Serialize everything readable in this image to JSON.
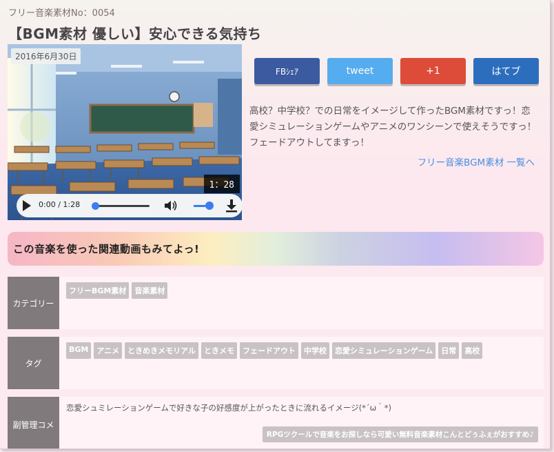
{
  "header": {
    "supertitle": "フリー音楽素材No：0054",
    "title": "【BGM素材 優しい】安心できる気持ち"
  },
  "media": {
    "date": "2016年6月30日",
    "duration": "1：28",
    "player": {
      "time": "0:00 / 1:28",
      "progress": 0,
      "volume": 1
    }
  },
  "share": {
    "facebook": "FBｼｪｱ",
    "twitter": "tweet",
    "gplus": "+1",
    "hatena": "はてブ"
  },
  "description": {
    "text": "高校？中学校？での日常をイメージして作ったBGM素材ですっ！恋愛シミュレーションゲームやアニメのワンシーンで使えそうですっ！フェードアウトしてますっ！",
    "link": "フリー音楽BGM素材 一覧へ"
  },
  "related": {
    "heading": "この音楽を使った関連動画もみてよっ!"
  },
  "meta": {
    "category": {
      "label": "カテゴリー",
      "items": [
        "フリーBGM素材",
        "音楽素材"
      ]
    },
    "tags": {
      "label": "タグ",
      "items": [
        "BGM",
        "アニメ",
        "ときめきメモリアル",
        "ときメモ",
        "フェードアウト",
        "中学校",
        "恋愛シミュレーションゲーム",
        "日常",
        "高校"
      ]
    },
    "admin_comment": {
      "label": "副管理コメ",
      "text": "恋愛シュミレーションゲームで好きな子の好感度が上がったときに流れるイメージ(*´ω｀*)",
      "recommend": "RPGツクールで音楽をお探しなら可愛い無料音楽素材こんとどぅふぇがおすすめ♪"
    }
  },
  "colors": {
    "facebook": "#3b5aa0",
    "twitter": "#55acee",
    "gplus": "#dd4b39",
    "hatena": "#2c6ebd",
    "link": "#4a8ee0",
    "label_bg": "#807a7d",
    "chip_bg": "#c9c2c5"
  }
}
